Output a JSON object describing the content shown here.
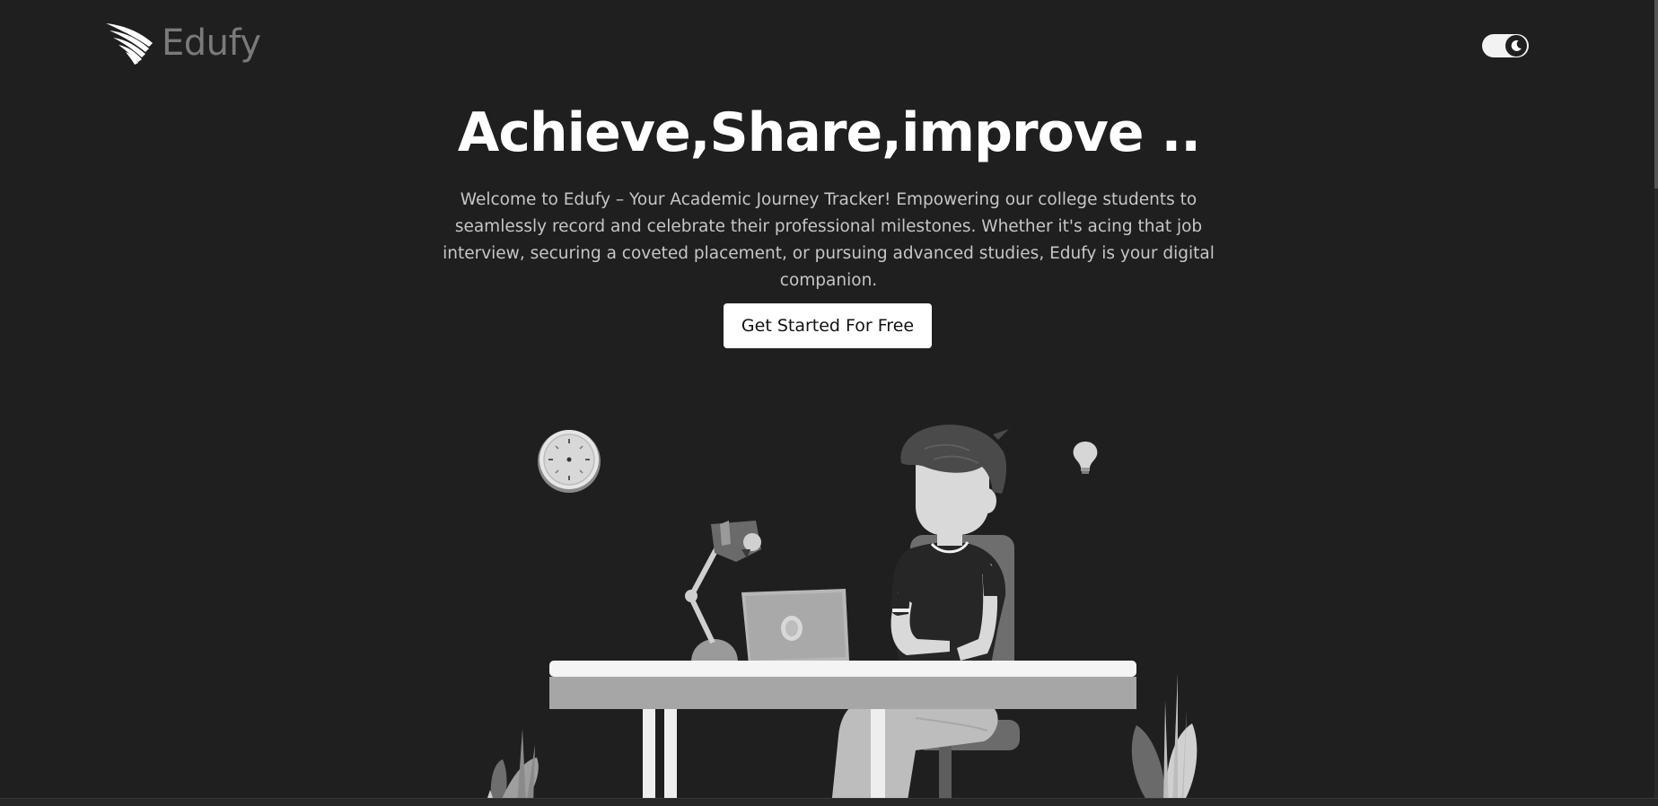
{
  "brand": {
    "name": "Edufy",
    "logo_icon": "wing-icon"
  },
  "header": {
    "theme_toggle": {
      "icon": "moon-icon",
      "state": "dark"
    }
  },
  "hero": {
    "title": "Achieve,Share,improve ..",
    "description": "Welcome to Edufy – Your Academic Journey Tracker! Empowering our college students to seamlessly record and celebrate their professional milestones. Whether it's acing that job interview, securing a coveted placement, or pursuing advanced studies, Edufy is your digital companion.",
    "cta_label": "Get Started For Free"
  },
  "illustration": {
    "subject": "student-at-desk-illustration",
    "elements": [
      "wall-clock-icon",
      "light-bulb-icon",
      "desk-lamp-icon",
      "laptop-icon",
      "plant-icon"
    ]
  },
  "colors": {
    "background": "#1f1f1f",
    "title": "#ffffff",
    "text": "#c6c6c6",
    "button_bg": "#ffffff",
    "button_text": "#111111",
    "logo": "#7a7a7a"
  }
}
